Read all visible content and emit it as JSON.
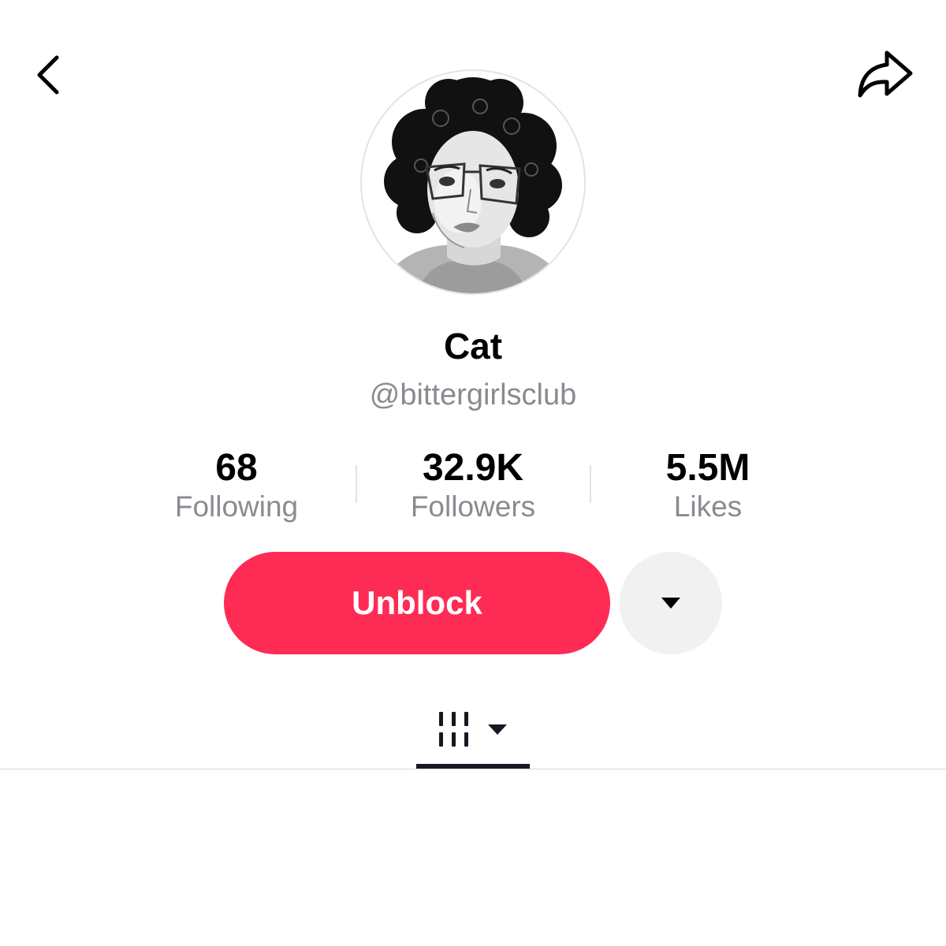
{
  "header": {
    "back_icon": "chevron-left-icon",
    "share_icon": "share-arrow-icon"
  },
  "profile": {
    "avatar_alt": "avatar",
    "display_name": "Cat",
    "handle": "@bittergirlsclub"
  },
  "stats": [
    {
      "value": "68",
      "label": "Following"
    },
    {
      "value": "32.9K",
      "label": "Followers"
    },
    {
      "value": "5.5M",
      "label": "Likes"
    }
  ],
  "actions": {
    "primary_label": "Unblock",
    "primary_color": "#fe2c55",
    "more_icon": "caret-down-icon"
  },
  "tabs": {
    "active_icon": "video-grid-icon",
    "dropdown_icon": "caret-down-icon"
  }
}
